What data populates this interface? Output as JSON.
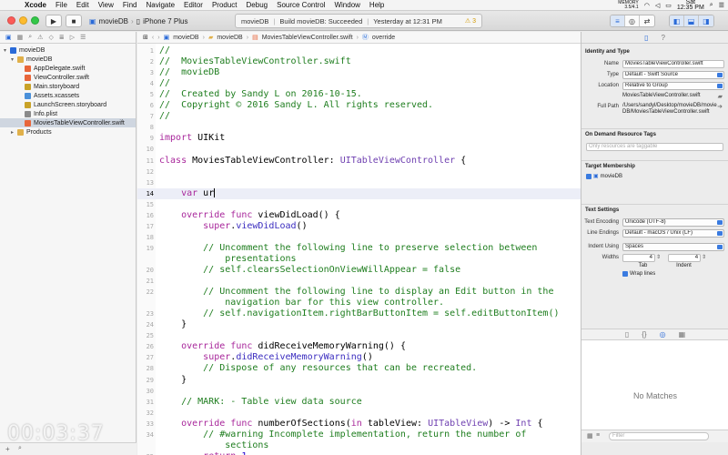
{
  "menubar": {
    "app": "Xcode",
    "items": [
      "File",
      "Edit",
      "View",
      "Find",
      "Navigate",
      "Editor",
      "Product",
      "Debug",
      "Source Control",
      "Window",
      "Help"
    ],
    "memory_label": "MEMORY",
    "memory_values": "3.5/4.1",
    "clock_day": "Sat",
    "clock_time": "12:35 PM"
  },
  "toolbar": {
    "scheme": "movieDB",
    "device": "iPhone 7 Plus",
    "status_project": "movieDB",
    "status_text": "Build movieDB: Succeeded",
    "status_time": "Yesterday at 12:31 PM",
    "warnings": "3"
  },
  "navigator": {
    "items": [
      {
        "label": "movieDB",
        "level": 0,
        "kind": "project",
        "disclosure": "▾"
      },
      {
        "label": "movieDB",
        "level": 1,
        "kind": "folder",
        "disclosure": "▾"
      },
      {
        "label": "AppDelegate.swift",
        "level": 2,
        "kind": "swift",
        "disclosure": ""
      },
      {
        "label": "ViewController.swift",
        "level": 2,
        "kind": "swift",
        "disclosure": ""
      },
      {
        "label": "Main.storyboard",
        "level": 2,
        "kind": "storyboard",
        "disclosure": ""
      },
      {
        "label": "Assets.xcassets",
        "level": 2,
        "kind": "assets",
        "disclosure": ""
      },
      {
        "label": "LaunchScreen.storyboard",
        "level": 2,
        "kind": "storyboard",
        "disclosure": ""
      },
      {
        "label": "Info.plist",
        "level": 2,
        "kind": "plist",
        "disclosure": ""
      },
      {
        "label": "MoviesTableViewController.swift",
        "level": 2,
        "kind": "swift",
        "disclosure": "",
        "selected": true
      },
      {
        "label": "Products",
        "level": 1,
        "kind": "folder",
        "disclosure": "▸"
      }
    ]
  },
  "jumpbar": {
    "items": [
      "movieDB",
      "movieDB",
      "MoviesTableViewController.swift",
      "override"
    ]
  },
  "editor": {
    "current_line": 14,
    "lines": [
      {
        "n": "1",
        "kind": "comment",
        "text": "//"
      },
      {
        "n": "2",
        "kind": "comment",
        "text": "//  MoviesTableViewController.swift"
      },
      {
        "n": "3",
        "kind": "comment",
        "text": "//  movieDB"
      },
      {
        "n": "4",
        "kind": "comment",
        "text": "//"
      },
      {
        "n": "5",
        "kind": "comment",
        "text": "//  Created by Sandy L on 2016-10-15."
      },
      {
        "n": "6",
        "kind": "comment",
        "text": "//  Copyright © 2016 Sandy L. All rights reserved."
      },
      {
        "n": "7",
        "kind": "comment",
        "text": "//"
      },
      {
        "n": "8",
        "kind": "blank",
        "text": ""
      },
      {
        "n": "9",
        "kind": "import",
        "text": "import UIKit"
      },
      {
        "n": "10",
        "kind": "blank",
        "text": ""
      },
      {
        "n": "11",
        "kind": "class",
        "text": "class MoviesTableViewController: UITableViewController {"
      },
      {
        "n": "12",
        "kind": "blank",
        "text": ""
      },
      {
        "n": "13",
        "kind": "blank",
        "text": ""
      },
      {
        "n": "14",
        "kind": "var",
        "text": "    var ur"
      },
      {
        "n": "15",
        "kind": "blank",
        "text": ""
      },
      {
        "n": "16",
        "kind": "func",
        "text": "    override func viewDidLoad() {"
      },
      {
        "n": "17",
        "kind": "super",
        "text": "        super.viewDidLoad()"
      },
      {
        "n": "18",
        "kind": "blank",
        "text": ""
      },
      {
        "n": "19",
        "kind": "comment",
        "text": "        // Uncomment the following line to preserve selection between"
      },
      {
        "n": "",
        "kind": "comment",
        "text": "            presentations"
      },
      {
        "n": "20",
        "kind": "comment",
        "text": "        // self.clearsSelectionOnViewWillAppear = false"
      },
      {
        "n": "21",
        "kind": "blank",
        "text": ""
      },
      {
        "n": "22",
        "kind": "comment",
        "text": "        // Uncomment the following line to display an Edit button in the"
      },
      {
        "n": "",
        "kind": "comment",
        "text": "            navigation bar for this view controller."
      },
      {
        "n": "23",
        "kind": "comment",
        "text": "        // self.navigationItem.rightBarButtonItem = self.editButtonItem()"
      },
      {
        "n": "24",
        "kind": "plain",
        "text": "    }"
      },
      {
        "n": "25",
        "kind": "blank",
        "text": ""
      },
      {
        "n": "26",
        "kind": "func",
        "text": "    override func didReceiveMemoryWarning() {"
      },
      {
        "n": "27",
        "kind": "super",
        "text": "        super.didReceiveMemoryWarning()"
      },
      {
        "n": "28",
        "kind": "comment",
        "text": "        // Dispose of any resources that can be recreated."
      },
      {
        "n": "29",
        "kind": "plain",
        "text": "    }"
      },
      {
        "n": "30",
        "kind": "blank",
        "text": ""
      },
      {
        "n": "31",
        "kind": "comment",
        "text": "    // MARK: - Table view data source"
      },
      {
        "n": "32",
        "kind": "blank",
        "text": ""
      },
      {
        "n": "33",
        "kind": "numsec",
        "text": "    override func numberOfSections(in tableView: UITableView) -> Int {"
      },
      {
        "n": "34",
        "kind": "comment",
        "text": "        // #warning Incomplete implementation, return the number of"
      },
      {
        "n": "",
        "kind": "comment",
        "text": "            sections"
      },
      {
        "n": "35",
        "kind": "return",
        "text": "        return 1"
      },
      {
        "n": "36",
        "kind": "plain",
        "text": "    }"
      }
    ]
  },
  "inspector": {
    "identity_title": "Identity and Type",
    "name_label": "Name",
    "name_value": "MoviesTableViewController.swift",
    "type_label": "Type",
    "type_value": "Default - Swift Source",
    "location_label": "Location",
    "location_value": "Relative to Group",
    "location_path": "MoviesTableViewController.swift",
    "fullpath_label": "Full Path",
    "fullpath_value": "/Users/sandyl/Desktop/movieDB/movieDB/MoviesTableViewController.swift",
    "odr_title": "On Demand Resource Tags",
    "odr_placeholder": "Only resources are taggable",
    "target_title": "Target Membership",
    "target_item": "movieDB",
    "text_title": "Text Settings",
    "encoding_label": "Text Encoding",
    "encoding_value": "Unicode (UTF-8)",
    "endings_label": "Line Endings",
    "endings_value": "Default - macOS / Unix (LF)",
    "indent_label": "Indent Using",
    "indent_value": "Spaces",
    "widths_label": "Widths",
    "tab_width": "4",
    "indent_width": "4",
    "tab_label": "Tab",
    "indent_sub_label": "Indent",
    "wrap_label": "Wrap lines",
    "no_matches": "No Matches",
    "filter_placeholder": "Filter"
  },
  "timer": "00:03:37",
  "colors": {
    "accent": "#2a6ad8",
    "comment": "#1e7d1e",
    "keyword": "#a8279b",
    "type": "#6e3fb0",
    "call": "#3a2cbf"
  }
}
